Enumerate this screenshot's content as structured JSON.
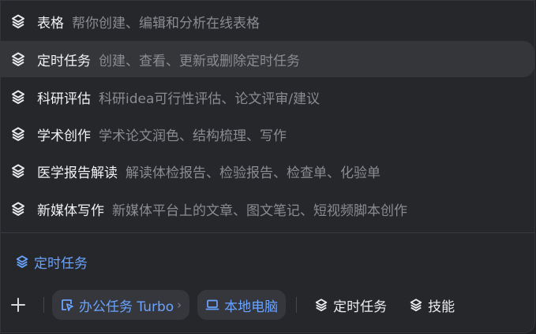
{
  "menu": {
    "items": [
      {
        "title": "表格",
        "desc": "帮你创建、编辑和分析在线表格"
      },
      {
        "title": "定时任务",
        "desc": "创建、查看、更新或删除定时任务"
      },
      {
        "title": "科研评估",
        "desc": "科研idea可行性评估、论文评审/建议"
      },
      {
        "title": "学术创作",
        "desc": "学术论文润色、结构梳理、写作"
      },
      {
        "title": "医学报告解读",
        "desc": "解读体检报告、检验报告、检查单、化验单"
      },
      {
        "title": "新媒体写作",
        "desc": "新媒体平台上的文章、图文笔记、短视频脚本创作"
      }
    ]
  },
  "selected_skill": {
    "label": "定时任务"
  },
  "toolbar": {
    "office_task_label": "办公任务 Turbo",
    "local_computer_label": "本地电脑",
    "scheduled_task_label": "定时任务",
    "skills_label": "技能"
  },
  "colors": {
    "background": "#26272b",
    "highlight_row": "#35363a",
    "accent_blue": "#6aa4ff",
    "muted_text": "#8a8c92"
  }
}
